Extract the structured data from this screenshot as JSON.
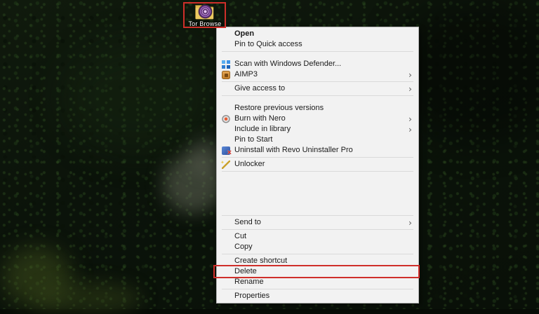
{
  "desktop": {
    "icon": {
      "label": "Tor Browse"
    }
  },
  "annotations": {
    "color": "#cf2f2a",
    "boxed_elements": [
      "Tor Browse desktop icon",
      "Delete menu item"
    ]
  },
  "colors": {
    "menu_background": "#f2f2f2",
    "tor_purple": "#59316b",
    "folder_yellow": "#dfb94f"
  },
  "context_menu": {
    "items": [
      {
        "label": "Open",
        "bold": true
      },
      {
        "label": "Pin to Quick access"
      },
      {
        "type": "separator"
      },
      {
        "type": "gap",
        "size": "s"
      },
      {
        "label": "Scan with Windows Defender...",
        "icon": "windows-defender"
      },
      {
        "label": "AIMP3",
        "icon": "aimp3",
        "arrow": true
      },
      {
        "type": "separator"
      },
      {
        "label": "Give access to",
        "arrow": true
      },
      {
        "type": "separator"
      },
      {
        "type": "gap",
        "size": "s"
      },
      {
        "label": "Restore previous versions"
      },
      {
        "label": "Burn with Nero",
        "icon": "nero",
        "arrow": true
      },
      {
        "label": "Include in library",
        "arrow": true
      },
      {
        "label": "Pin to Start"
      },
      {
        "label": "Uninstall with Revo Uninstaller Pro",
        "icon": "revo"
      },
      {
        "type": "separator"
      },
      {
        "label": "Unlocker",
        "icon": "unlocker"
      },
      {
        "type": "separator"
      },
      {
        "type": "gap",
        "size": "l"
      },
      {
        "type": "separator"
      },
      {
        "label": "Send to",
        "arrow": true
      },
      {
        "type": "separator"
      },
      {
        "label": "Cut"
      },
      {
        "label": "Copy"
      },
      {
        "type": "separator"
      },
      {
        "label": "Create shortcut"
      },
      {
        "label": "Delete",
        "highlighted": true
      },
      {
        "label": "Rename"
      },
      {
        "type": "separator"
      },
      {
        "label": "Properties"
      }
    ]
  }
}
